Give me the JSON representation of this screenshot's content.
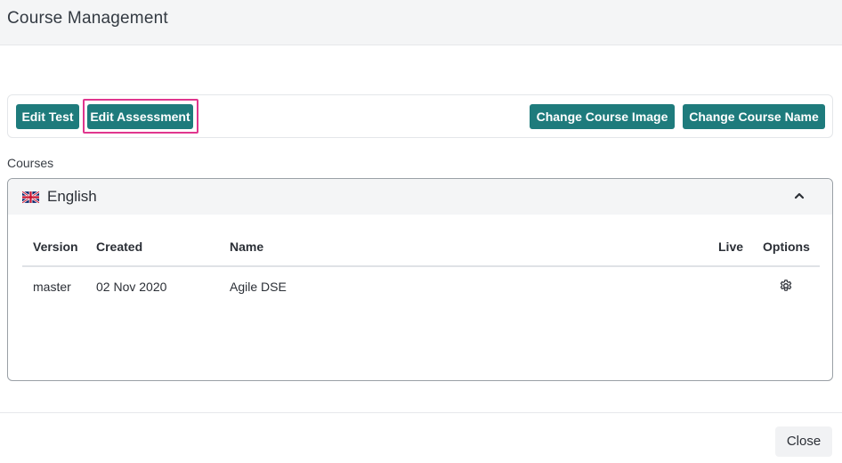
{
  "header": {
    "title": "Course Management"
  },
  "toolbar": {
    "edit_test": "Edit Test",
    "edit_assessment": "Edit Assessment",
    "change_image": "Change Course Image",
    "change_name": "Change Course Name"
  },
  "courses_label": "Courses",
  "panel": {
    "language": "English",
    "columns": {
      "version": "Version",
      "created": "Created",
      "name": "Name",
      "live": "Live",
      "options": "Options"
    },
    "rows": [
      {
        "version": "master",
        "created": "02 Nov 2020",
        "name": "Agile DSE",
        "live": ""
      }
    ]
  },
  "footer": {
    "close": "Close"
  },
  "colors": {
    "primary": "#1e7b7c",
    "highlight": "#e0368e"
  },
  "icons": {
    "flag": "uk-flag-icon",
    "collapse": "chevron-up-icon",
    "options": "gear-icon"
  }
}
